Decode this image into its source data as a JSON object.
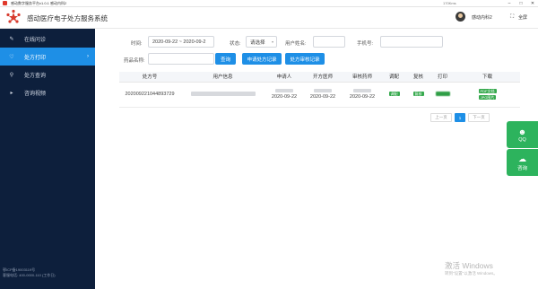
{
  "os_titlebar": {
    "title": "感动数字服务平台v1.0.1 感动内科2",
    "speed": "170Kms",
    "min_icon": "minimize-icon",
    "max_icon": "maximize-icon",
    "close_icon": "close-icon"
  },
  "header": {
    "app_title": "感动医疗电子处方服务系统",
    "username": "感动内科2",
    "fullscreen_label": "全屏"
  },
  "sidebar": {
    "items": [
      {
        "label": "在线问诊",
        "icon": "edit-icon",
        "active": false
      },
      {
        "label": "处方打印",
        "icon": "heart-icon",
        "active": true
      },
      {
        "label": "处方查询",
        "icon": "search-icon",
        "active": false
      },
      {
        "label": "咨询视频",
        "icon": "video-icon",
        "active": false
      }
    ],
    "footer_line1": "鄂ICP备19003119号",
    "footer_line2": "客服电话: 400-0000-110 (工作日)"
  },
  "filters": {
    "time_label": "时间:",
    "time_value": "2020-09-22 ~ 2020-09-2",
    "status_label": "状态:",
    "status_value": "请选择",
    "user_name_label": "用户姓名:",
    "phone_label": "手机号:",
    "drug_label": "药品名称:",
    "query_button": "查询",
    "apply_record_button": "申请处方记录",
    "review_record_button": "处方审核记录"
  },
  "table": {
    "columns": [
      "处方号",
      "用户信息",
      "申请人",
      "开方医师",
      "审核药师",
      "调配",
      "复核",
      "打印",
      "下载"
    ],
    "rows": [
      {
        "rx_no": "20200922104489372​9",
        "applicant_date": "2020-09-22",
        "doctor_date": "2020-09-22",
        "pharmacist_date": "2020-09-22",
        "dispense": "调配",
        "review": "复核",
        "download_pdf": "PDF文档",
        "download_jpg": "JPG图片"
      }
    ]
  },
  "pagination": {
    "prev": "上一页",
    "current": "1",
    "next": "下一页"
  },
  "float_widgets": {
    "qq_label": "QQ",
    "qq_icon": "qq-icon",
    "consult_label": "咨询",
    "consult_icon": "chat-icon"
  },
  "watermark": {
    "line1": "激活 Windows",
    "line2": "转到\"设置\"以激活 Windows。"
  },
  "colors": {
    "sidebar_bg": "#0d1f3c",
    "accent_blue": "#1e8fe6",
    "tag_green": "#36a94d",
    "float_green": "#2db35d"
  }
}
